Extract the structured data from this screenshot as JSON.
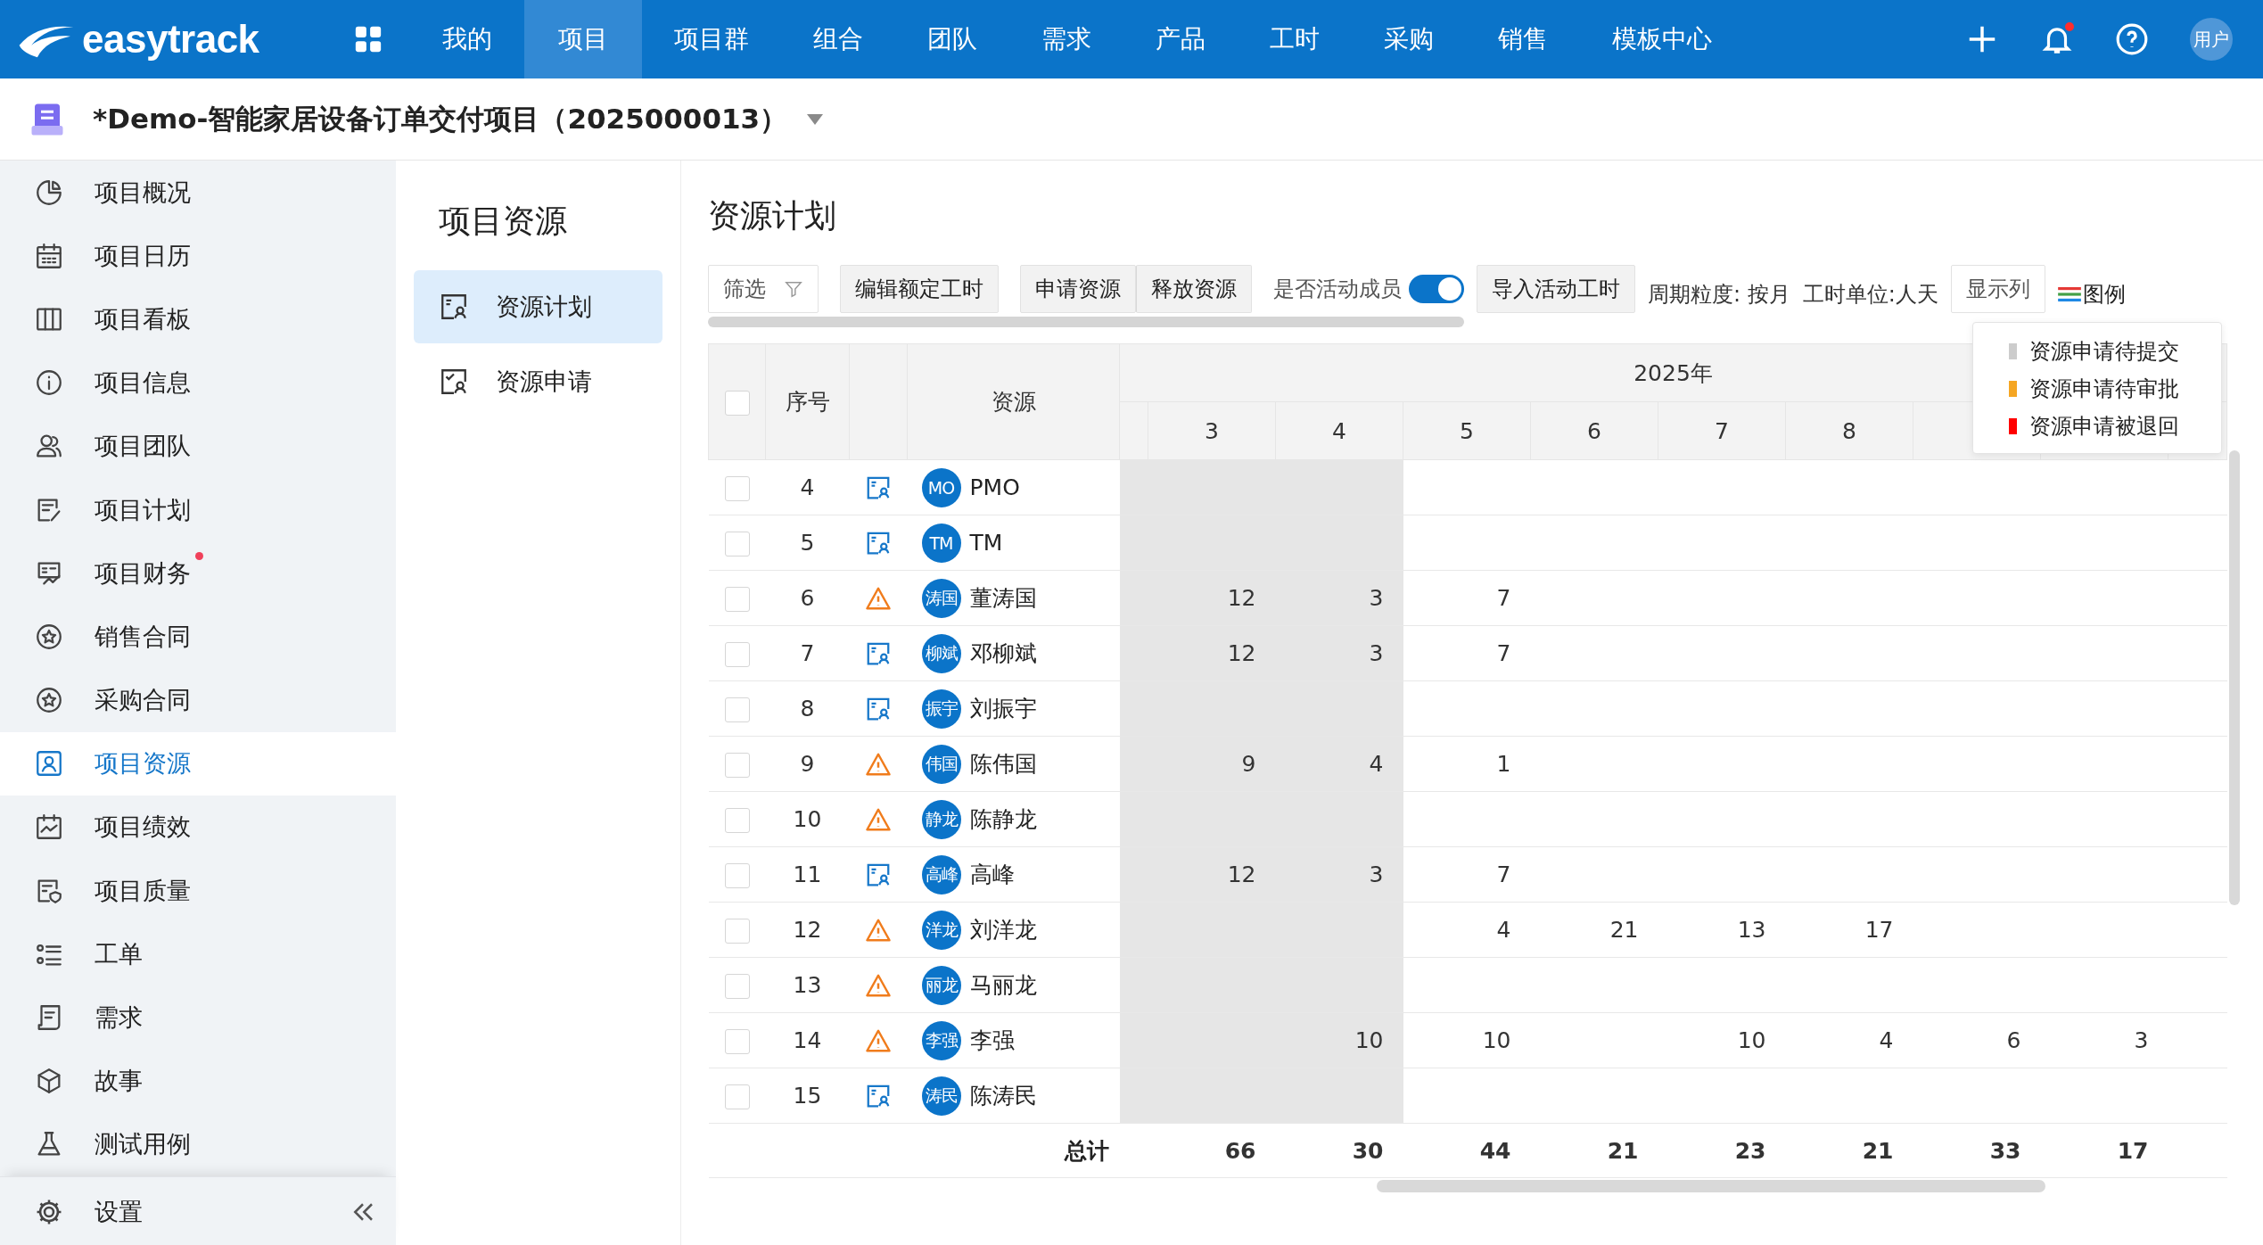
{
  "top_nav": {
    "logo": "easytrack",
    "items": [
      {
        "label": "我的",
        "selected": false
      },
      {
        "label": "项目",
        "selected": true
      },
      {
        "label": "项目群",
        "selected": false
      },
      {
        "label": "组合",
        "selected": false
      },
      {
        "label": "团队",
        "selected": false
      },
      {
        "label": "需求",
        "selected": false
      },
      {
        "label": "产品",
        "selected": false
      },
      {
        "label": "工时",
        "selected": false
      },
      {
        "label": "采购",
        "selected": false
      },
      {
        "label": "销售",
        "selected": false
      },
      {
        "label": "模板中心",
        "selected": false
      }
    ],
    "notification_dot": true,
    "avatar": "用户"
  },
  "project": {
    "title": "*Demo-智能家居设备订单交付项目（2025000013）"
  },
  "sidebar": {
    "items": [
      {
        "label": "项目概况",
        "selected": false,
        "badge": false
      },
      {
        "label": "项目日历",
        "selected": false,
        "badge": false
      },
      {
        "label": "项目看板",
        "selected": false,
        "badge": false
      },
      {
        "label": "项目信息",
        "selected": false,
        "badge": false
      },
      {
        "label": "项目团队",
        "selected": false,
        "badge": false
      },
      {
        "label": "项目计划",
        "selected": false,
        "badge": false
      },
      {
        "label": "项目财务",
        "selected": false,
        "badge": true
      },
      {
        "label": "销售合同",
        "selected": false,
        "badge": false
      },
      {
        "label": "采购合同",
        "selected": false,
        "badge": false
      },
      {
        "label": "项目资源",
        "selected": true,
        "badge": false
      },
      {
        "label": "项目绩效",
        "selected": false,
        "badge": false
      },
      {
        "label": "项目质量",
        "selected": false,
        "badge": false
      },
      {
        "label": "工单",
        "selected": false,
        "badge": false
      },
      {
        "label": "需求",
        "selected": false,
        "badge": false
      },
      {
        "label": "故事",
        "selected": false,
        "badge": false
      },
      {
        "label": "测试用例",
        "selected": false,
        "badge": false
      }
    ],
    "footer": "设置"
  },
  "subnav": {
    "title": "项目资源",
    "items": [
      {
        "label": "资源计划",
        "selected": true
      },
      {
        "label": "资源申请",
        "selected": false
      }
    ]
  },
  "page": {
    "title": "资源计划"
  },
  "toolbar": {
    "filter": "筛选",
    "edit_button": "编辑额定工时",
    "group": [
      "申请资源",
      "释放资源"
    ],
    "active_only": {
      "label": "是否活动成员",
      "on": true
    },
    "import_button": "导入活动工时",
    "period": "周期粒度: 按月",
    "unit": "工时单位:人天",
    "columns_button": "显示列",
    "legend_button": "图例"
  },
  "legend": [
    {
      "label": "资源申请待提交",
      "color": "#cccccc"
    },
    {
      "label": "资源申请待审批",
      "color": "#f5a623"
    },
    {
      "label": "资源申请被退回",
      "color": "#ff0000"
    }
  ],
  "table": {
    "select_all_checked": false,
    "columns": [
      "序号",
      "资源"
    ],
    "year": "2025年",
    "months": [
      {
        "label": "3",
        "shaded": true
      },
      {
        "label": "4",
        "shaded": true
      },
      {
        "label": "5",
        "shaded": false
      },
      {
        "label": "6",
        "shaded": false
      },
      {
        "label": "7",
        "shaded": false
      },
      {
        "label": "8",
        "shaded": false
      },
      {
        "shaded": false
      },
      {
        "shaded": false
      }
    ],
    "rows": [
      {
        "checked": false,
        "seq": "4",
        "kind": "plan",
        "avatar": "MO",
        "name": "PMO",
        "cells": [
          {},
          {},
          {},
          {},
          {},
          {},
          {},
          {}
        ]
      },
      {
        "checked": false,
        "seq": "5",
        "kind": "plan",
        "avatar": "TM",
        "name": "TM",
        "cells": [
          {},
          {},
          {},
          {},
          {},
          {},
          {},
          {}
        ]
      },
      {
        "checked": false,
        "seq": "6",
        "kind": "warning",
        "avatar": "涛国",
        "name": "董涛国",
        "cells": [
          {
            "value": "12"
          },
          {
            "value": "3"
          },
          {
            "value": "7"
          },
          {},
          {},
          {},
          {},
          {}
        ]
      },
      {
        "checked": false,
        "seq": "7",
        "kind": "plan",
        "avatar": "柳斌",
        "name": "邓柳斌",
        "cells": [
          {
            "value": "12"
          },
          {
            "value": "3"
          },
          {
            "value": "7"
          },
          {},
          {},
          {},
          {},
          {}
        ]
      },
      {
        "checked": false,
        "seq": "8",
        "kind": "plan",
        "avatar": "振宇",
        "name": "刘振宇",
        "cells": [
          {},
          {},
          {},
          {},
          {},
          {},
          {},
          {}
        ]
      },
      {
        "checked": false,
        "seq": "9",
        "kind": "warning",
        "avatar": "伟国",
        "name": "陈伟国",
        "cells": [
          {
            "value": "9"
          },
          {
            "value": "4"
          },
          {
            "value": "1"
          },
          {},
          {},
          {},
          {},
          {}
        ]
      },
      {
        "checked": false,
        "seq": "10",
        "kind": "warning",
        "avatar": "静龙",
        "name": "陈静龙",
        "cells": [
          {},
          {},
          {},
          {},
          {},
          {},
          {},
          {}
        ]
      },
      {
        "checked": false,
        "seq": "11",
        "kind": "plan",
        "avatar": "高峰",
        "name": "高峰",
        "cells": [
          {
            "value": "12"
          },
          {
            "value": "3"
          },
          {
            "value": "7"
          },
          {},
          {},
          {},
          {},
          {}
        ]
      },
      {
        "checked": false,
        "seq": "12",
        "kind": "warning",
        "avatar": "洋龙",
        "name": "刘洋龙",
        "cells": [
          {},
          {},
          {
            "value": "4"
          },
          {
            "value": "21"
          },
          {
            "value": "13"
          },
          {
            "value": "17"
          },
          {},
          {}
        ]
      },
      {
        "checked": false,
        "seq": "13",
        "kind": "warning",
        "avatar": "丽龙",
        "name": "马丽龙",
        "cells": [
          {},
          {},
          {},
          {},
          {},
          {},
          {},
          {}
        ]
      },
      {
        "checked": false,
        "seq": "14",
        "kind": "warning",
        "avatar": "李强",
        "name": "李强",
        "cells": [
          {},
          {
            "value": "10"
          },
          {
            "value": "10"
          },
          {},
          {
            "value": "10"
          },
          {
            "value": "4"
          },
          {
            "value": "6"
          },
          {
            "value": "3"
          }
        ]
      },
      {
        "checked": false,
        "seq": "15",
        "kind": "plan",
        "avatar": "涛民",
        "name": "陈涛民",
        "cells": [
          {},
          {},
          {},
          {},
          {},
          {},
          {},
          {}
        ]
      }
    ],
    "total_label": "总计",
    "totals": [
      "66",
      "30",
      "44",
      "21",
      "23",
      "21",
      "33",
      "17"
    ]
  }
}
